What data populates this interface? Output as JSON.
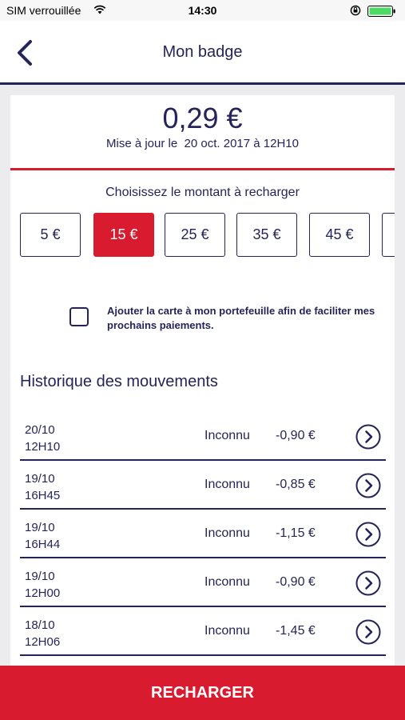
{
  "status_bar": {
    "carrier": "SIM verrouillée",
    "time": "14:30"
  },
  "nav": {
    "title": "Mon badge"
  },
  "balance": {
    "amount": "0,29 €",
    "updated_prefix": "Mise à jour le",
    "updated_date": "20 oct. 2017 à 12H10"
  },
  "recharge": {
    "title": "Choisissez le montant à recharger",
    "amounts": [
      {
        "label": "5 €",
        "selected": false
      },
      {
        "label": "15 €",
        "selected": true
      },
      {
        "label": "25 €",
        "selected": false
      },
      {
        "label": "35 €",
        "selected": false
      },
      {
        "label": "45 €",
        "selected": false
      }
    ]
  },
  "wallet": {
    "checked": false,
    "label": "Ajouter la carte à mon portefeuille afin de faciliter mes prochains paiements."
  },
  "history": {
    "title": "Historique des mouvements",
    "rows": [
      {
        "date": "20/10",
        "time": "12H10",
        "status": "Inconnu",
        "amount": "-0,90 €"
      },
      {
        "date": "19/10",
        "time": "16H45",
        "status": "Inconnu",
        "amount": "-0,85 €"
      },
      {
        "date": "19/10",
        "time": "16H44",
        "status": "Inconnu",
        "amount": "-1,15 €"
      },
      {
        "date": "19/10",
        "time": "12H00",
        "status": "Inconnu",
        "amount": "-0,90 €"
      },
      {
        "date": "18/10",
        "time": "12H06",
        "status": "Inconnu",
        "amount": "-1,45 €"
      }
    ]
  },
  "cta": {
    "label": "RECHARGER"
  },
  "colors": {
    "navy": "#25245a",
    "red": "#d81b2e",
    "background": "#ececef"
  }
}
